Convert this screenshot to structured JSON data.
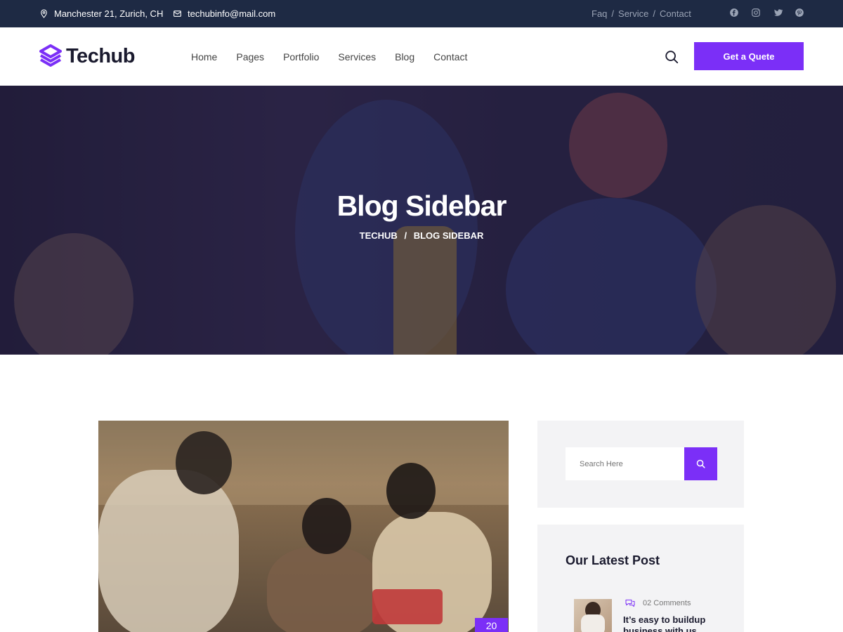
{
  "topbar": {
    "address": "Manchester 21, Zurich, CH",
    "email": "techubinfo@mail.com",
    "links": [
      "Faq",
      "Service",
      "Contact"
    ],
    "social": [
      "facebook-icon",
      "instagram-icon",
      "twitter-icon",
      "pinterest-icon"
    ]
  },
  "header": {
    "logo": "Techub",
    "nav": [
      "Home",
      "Pages",
      "Portfolio",
      "Services",
      "Blog",
      "Contact"
    ],
    "cta": "Get a Quete"
  },
  "hero": {
    "title": "Blog Sidebar",
    "breadcrumb": [
      "TECHUB",
      "BLOG SIDEBAR"
    ]
  },
  "post": {
    "date_day": "20"
  },
  "sidebar": {
    "search_placeholder": "Search Here",
    "latest_title": "Our Latest Post",
    "latest_posts": [
      {
        "comments": "02 Comments",
        "title": "It’s easy to buildup business with us"
      }
    ]
  },
  "colors": {
    "accent": "#7b2ff7",
    "topbar": "#1e2a44",
    "sidebar_bg": "#f3f3f5"
  }
}
